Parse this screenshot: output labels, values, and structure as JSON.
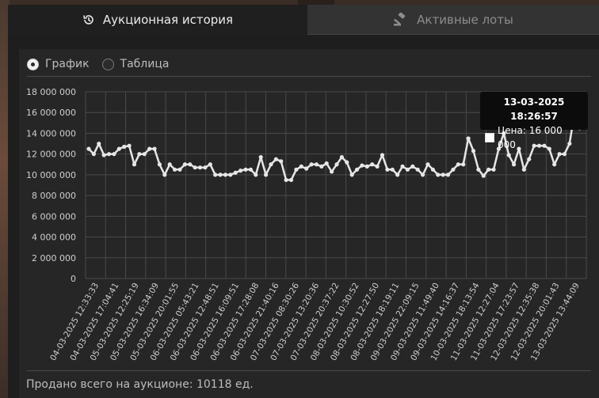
{
  "tabs": {
    "history_label": "Аукционная история",
    "active_label": "Активные лоты"
  },
  "view": {
    "chart_label": "График",
    "table_label": "Таблица"
  },
  "footer": {
    "sold_text": "Продано всего на аукционе: 10118 ед."
  },
  "tooltip": {
    "date": "13-03-2025 18:26:57",
    "price_text": "Цена: 16 000 000"
  },
  "colors": {
    "line": "#e6e6e6",
    "grid": "#4a4a4a",
    "axis_text": "#cfcfcf"
  },
  "chart_data": {
    "type": "line",
    "xlabel": "",
    "ylabel": "",
    "ylim": [
      0,
      18000000
    ],
    "yticks": [
      0,
      2000000,
      4000000,
      6000000,
      8000000,
      10000000,
      12000000,
      14000000,
      16000000,
      18000000
    ],
    "ytick_labels": [
      "0",
      "2 000 000",
      "4 000 000",
      "6 000 000",
      "8 000 000",
      "10 000 000",
      "12 000 000",
      "14 000 000",
      "16 000 000",
      "18 000 000"
    ],
    "xtick_labels": [
      "04-03-2025 12:33:33",
      "04-03-2025 17:04:41",
      "05-03-2025 12:25:19",
      "05-03-2025 16:34:09",
      "05-03-2025 20:01:55",
      "06-03-2025 05:43:21",
      "06-03-2025 12:48:51",
      "06-03-2025 16:09:51",
      "06-03-2025 17:28:08",
      "06-03-2025 21:40:16",
      "07-03-2025 08:30:26",
      "07-03-2025 13:20:36",
      "07-03-2025 20:37:22",
      "08-03-2025 10:30:52",
      "08-03-2025 12:27:50",
      "08-03-2025 18:19:11",
      "09-03-2025 22:09:15",
      "09-03-2025 11:49:40",
      "09-03-2025 14:16:37",
      "10-03-2025 18:13:54",
      "11-03-2025 12:27:04",
      "11-03-2025 17:23:57",
      "12-03-2025 12:35:38",
      "12-03-2025 20:01:43",
      "13-03-2025 13:44:09"
    ],
    "series": [
      {
        "values": [
          12500000,
          12000000,
          13000000,
          11900000,
          12000000,
          12000000,
          12500000,
          12700000,
          12800000,
          11000000,
          12000000,
          12000000,
          12500000,
          12500000,
          11000000,
          10000000,
          11000000,
          10500000,
          10500000,
          11000000,
          11000000,
          10700000,
          10700000,
          10700000,
          11000000,
          10000000,
          10000000,
          10000000,
          10000000,
          10200000,
          10400000,
          10500000,
          10500000,
          10000000,
          11700000,
          10000000,
          11000000,
          11500000,
          11300000,
          9500000,
          9500000,
          10500000,
          10800000,
          10600000,
          11000000,
          11000000,
          10800000,
          11100000,
          10300000,
          11000000,
          11700000,
          11200000,
          10000000,
          10500000,
          10900000,
          10800000,
          11000000,
          10800000,
          11900000,
          10500000,
          10500000,
          10000000,
          10800000,
          10500000,
          10800000,
          10500000,
          10000000,
          11000000,
          10500000,
          10000000,
          10000000,
          10000000,
          10500000,
          11000000,
          11000000,
          13500000,
          12300000,
          10500000,
          9900000,
          10500000,
          10500000,
          12500000,
          14000000,
          11900000,
          11000000,
          12500000,
          10500000,
          11500000,
          12800000,
          12800000,
          12800000,
          12500000,
          11000000,
          12000000,
          12000000,
          13000000,
          16000000,
          14500000,
          16000000
        ]
      }
    ]
  }
}
